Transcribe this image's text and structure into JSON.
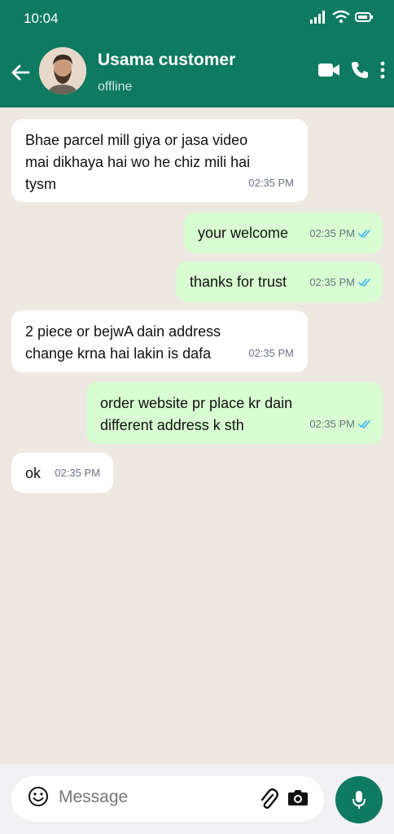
{
  "status_bar": {
    "time": "10:04"
  },
  "header": {
    "contact_name": "Usama customer",
    "contact_status": "offline"
  },
  "messages": [
    {
      "direction": "in",
      "lines": [
        "Bhae parcel mill giya or jasa video",
        "mai dikhaya hai wo he chiz mili hai",
        "tysm"
      ],
      "time": "02:35 PM"
    },
    {
      "direction": "out",
      "lines": [
        "your welcome"
      ],
      "time": "02:35 PM",
      "read": true
    },
    {
      "direction": "out",
      "lines": [
        "thanks for trust"
      ],
      "time": "02:35 PM",
      "read": true
    },
    {
      "direction": "in",
      "lines": [
        "2 piece or bejwA dain address",
        "change krna hai lakin is dafa"
      ],
      "time": "02:35 PM"
    },
    {
      "direction": "out",
      "lines": [
        "order website pr place kr dain",
        "different address k sth"
      ],
      "time": "02:35 PM",
      "read": true
    },
    {
      "direction": "in",
      "lines": [
        "ok"
      ],
      "time": "02:35 PM"
    }
  ],
  "composer": {
    "placeholder": "Message"
  },
  "colors": {
    "header": "#0e7a5f",
    "chat_bg": "#ede8e1",
    "outgoing": "#d8fdd2",
    "incoming": "#ffffff",
    "read_ticks": "#53bdeb"
  }
}
